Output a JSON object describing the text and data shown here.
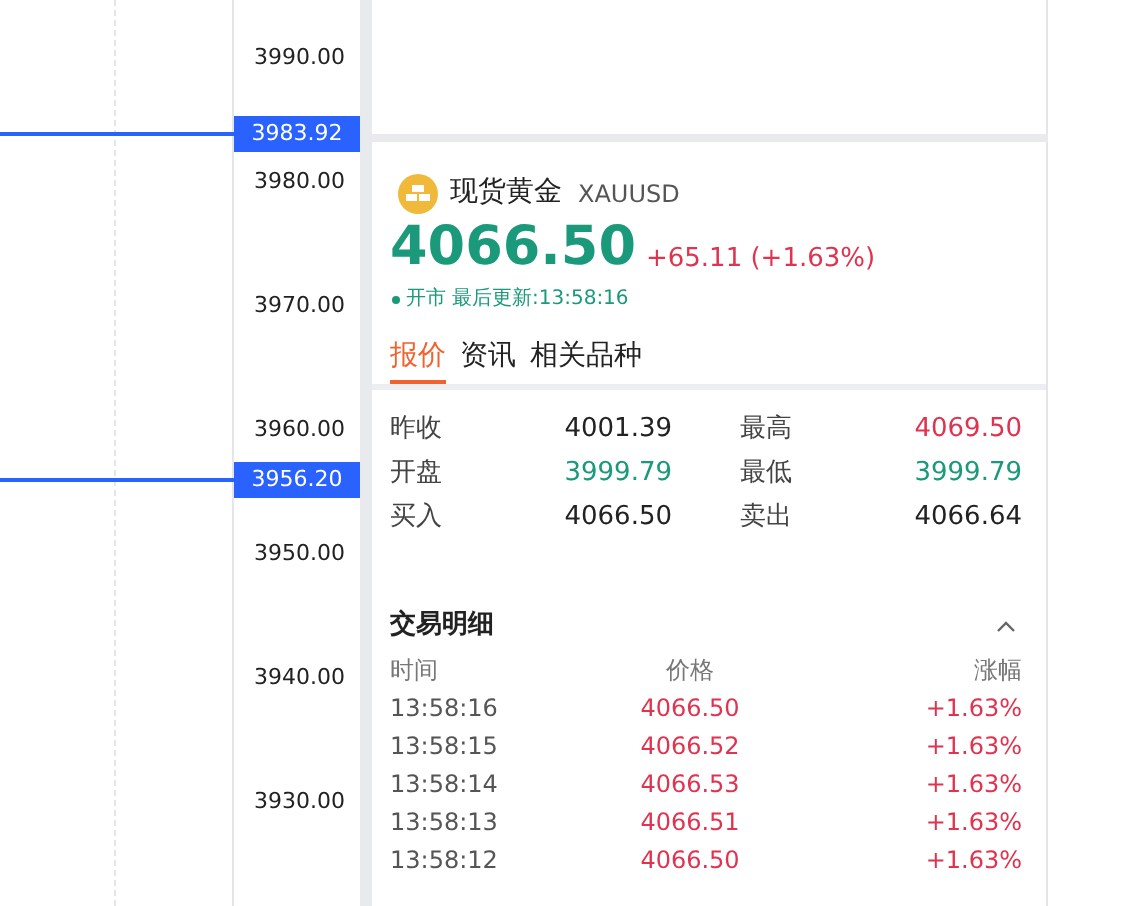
{
  "chart": {
    "axis_labels": [
      "3990.00",
      "3980.00",
      "3970.00",
      "3960.00",
      "3950.00",
      "3940.00",
      "3930.00"
    ],
    "price_lines": [
      {
        "label": "3983.92"
      },
      {
        "label": "3956.20"
      }
    ]
  },
  "quote": {
    "name": "现货黄金",
    "symbol": "XAUUSD",
    "price": "4066.50",
    "change": "+65.11 (+1.63%)",
    "market_status": "开市",
    "updated": "最后更新:13:58:16",
    "tabs": [
      {
        "label": "报价",
        "selected": true
      },
      {
        "label": "资讯",
        "selected": false
      },
      {
        "label": "相关品种",
        "selected": false
      }
    ],
    "stats": [
      {
        "label": "昨收",
        "value": "4001.39",
        "color": "#222222"
      },
      {
        "label": "最高",
        "value": "4069.50",
        "color": "#e0334f"
      },
      {
        "label": "开盘",
        "value": "3999.79",
        "color": "#1a9a7a"
      },
      {
        "label": "最低",
        "value": "3999.79",
        "color": "#1a9a7a"
      },
      {
        "label": "买入",
        "value": "4066.50",
        "color": "#222222"
      },
      {
        "label": "卖出",
        "value": "4066.64",
        "color": "#222222"
      }
    ],
    "trades": {
      "title": "交易明细",
      "expanded": true,
      "columns": [
        "时间",
        "价格",
        "涨幅"
      ],
      "rows": [
        {
          "time": "13:58:16",
          "price": "4066.50",
          "change": "+1.63%",
          "color": "#e0334f"
        },
        {
          "time": "13:58:15",
          "price": "4066.52",
          "change": "+1.63%",
          "color": "#e0334f"
        },
        {
          "time": "13:58:14",
          "price": "4066.53",
          "change": "+1.63%",
          "color": "#e0334f"
        },
        {
          "time": "13:58:13",
          "price": "4066.51",
          "change": "+1.63%",
          "color": "#e0334f"
        },
        {
          "time": "13:58:12",
          "price": "4066.50",
          "change": "+1.63%",
          "color": "#e0334f"
        }
      ]
    }
  }
}
